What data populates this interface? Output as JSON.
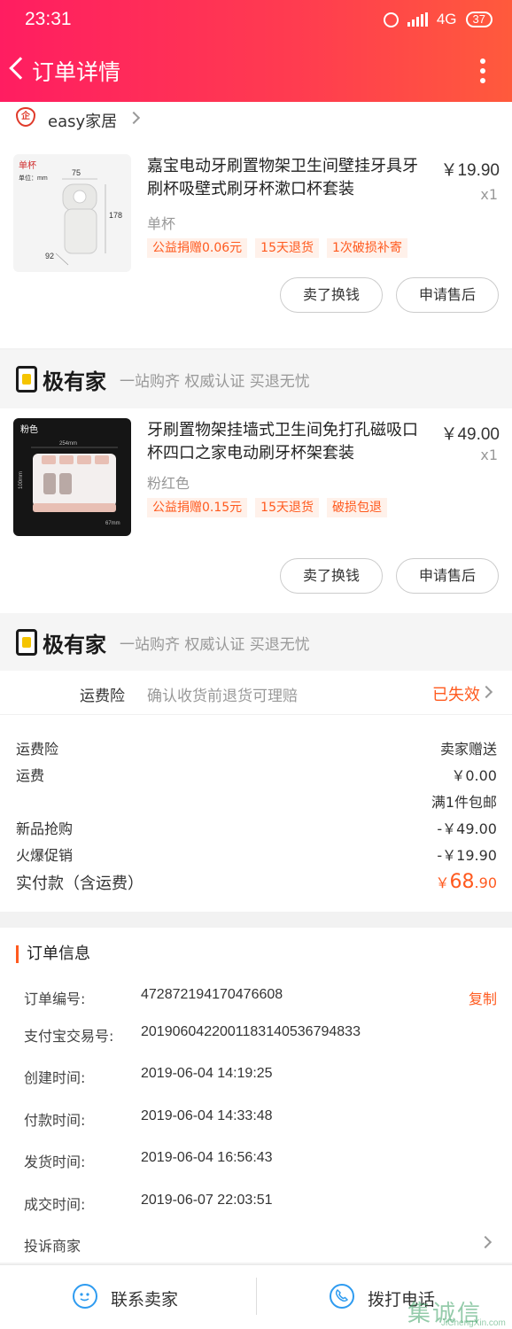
{
  "status_bar": {
    "time": "23:31",
    "network": "4G",
    "battery": "37"
  },
  "nav": {
    "title": "订单详情"
  },
  "shop": {
    "name": "easy家居",
    "logo_text": "企"
  },
  "items": [
    {
      "thumb_label": "单杯",
      "thumb_unit": "单位：mm",
      "thumb_dims": [
        "75",
        "178",
        "92"
      ],
      "name": "嘉宝电动牙刷置物架卫生间壁挂牙具牙刷杯吸壁式刷牙杯漱口杯套装",
      "price": "￥19.90",
      "qty": "x1",
      "sku": "单杯",
      "tags": [
        "公益捐赠0.06元",
        "15天退货",
        "1次破损补寄"
      ],
      "btn_exchange": "卖了换钱",
      "btn_aftersale": "申请售后"
    },
    {
      "thumb_label": "粉色",
      "thumb_dims": [
        "254mm",
        "100mm",
        "67mm"
      ],
      "name": "牙刷置物架挂墙式卫生间免打孔磁吸口杯四口之家电动刷牙杯架套装",
      "price": "￥49.00",
      "qty": "x1",
      "sku": "粉红色",
      "tags": [
        "公益捐赠0.15元",
        "15天退货",
        "破损包退"
      ],
      "btn_exchange": "卖了换钱",
      "btn_aftersale": "申请售后"
    }
  ],
  "banner": {
    "name": "极有家",
    "slogan": "一站购齐 权威认证 买退无忧"
  },
  "insurance": {
    "label": "运费险",
    "desc": "确认收货前退货可理赔",
    "status": "已失效"
  },
  "fees": {
    "rows": [
      {
        "label": "运费险",
        "value": "卖家赠送"
      },
      {
        "label": "运费",
        "value": "￥0.00"
      },
      {
        "label": "",
        "value": "满1件包邮"
      },
      {
        "label": "新品抢购",
        "value": "-￥49.00"
      },
      {
        "label": "火爆促销",
        "value": "-￥19.90"
      }
    ],
    "total_label": "实付款（含运费）",
    "total_symbol": "￥",
    "total_int": "68",
    "total_dec": ".90"
  },
  "order_info": {
    "title": "订单信息",
    "rows": [
      {
        "label": "订单编号:",
        "value": "472872194170476608"
      },
      {
        "label": "支付宝交易号:",
        "value": "2019060422001183140536794833"
      },
      {
        "label": "创建时间:",
        "value": "2019-06-04 14:19:25"
      },
      {
        "label": "付款时间:",
        "value": "2019-06-04 14:33:48"
      },
      {
        "label": "发货时间:",
        "value": "2019-06-04 16:56:43"
      },
      {
        "label": "成交时间:",
        "value": "2019-06-07 22:03:51"
      }
    ],
    "copy_label": "复制",
    "complaint": "投诉商家"
  },
  "bottom": {
    "contact": "联系卖家",
    "call": "拨打电话"
  },
  "watermark": {
    "big": "集诚信",
    "small": "JiChengXin.com"
  }
}
